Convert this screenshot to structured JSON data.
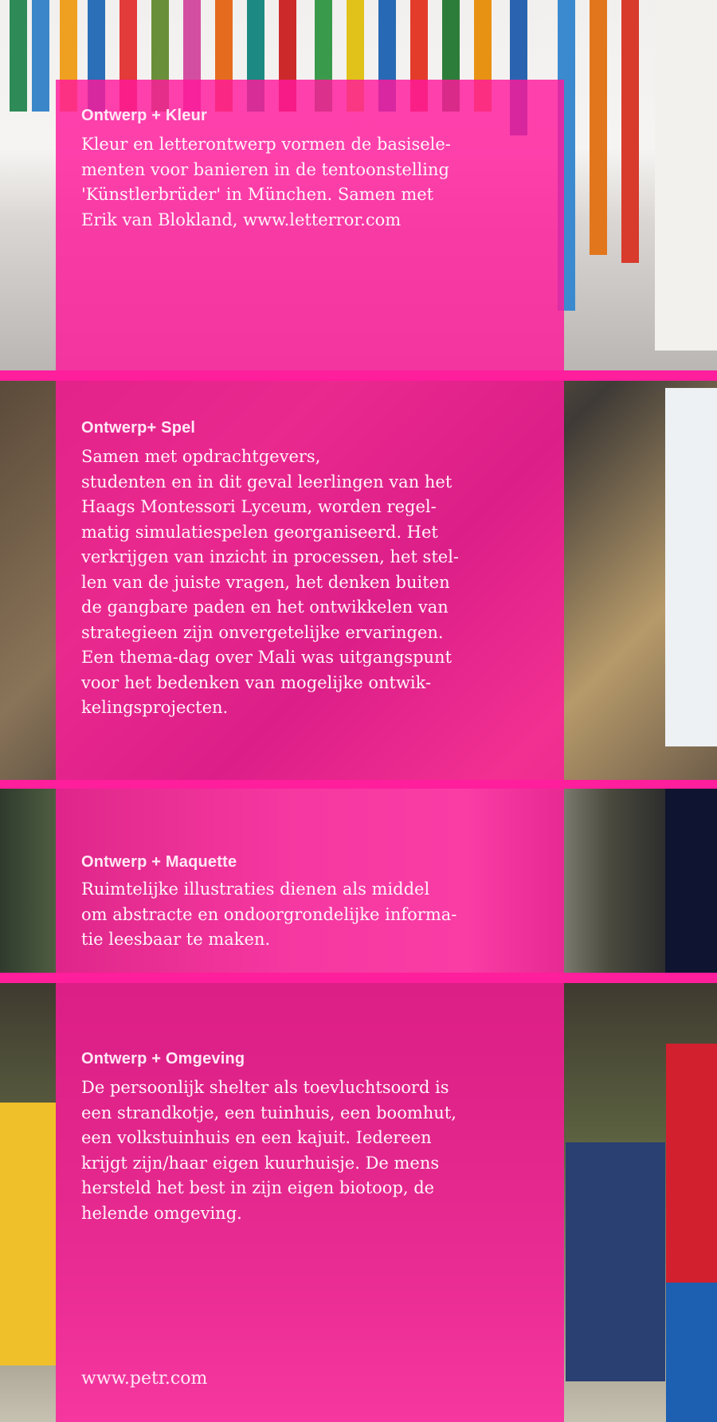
{
  "sections": [
    {
      "heading": "Ontwerp + Kleur",
      "lines": [
        "Kleur en letterontwerp vormen de basisele-",
        "menten voor banieren in de tentoonstelling",
        "'Künstlerbrüder' in München. Samen met",
        "Erik van Blokland, www.letterror.com"
      ]
    },
    {
      "heading": "Ontwerp+ Spel",
      "lines": [
        "Samen met opdrachtgevers,",
        "studenten en in dit geval leerlingen van het",
        "Haags Montessori Lyceum, worden regel-",
        "matig simulatiespelen georganiseerd. Het",
        "verkrijgen van inzicht in processen, het stel-",
        "len van de juiste vragen, het denken buiten",
        "de gangbare paden en het ontwikkelen van",
        "strategieen zijn onvergetelijke ervaringen.",
        "Een thema-dag over Mali was uitgangspunt",
        "voor het bedenken van mogelijke ontwik-",
        "kelingsprojecten."
      ]
    },
    {
      "heading": "Ontwerp + Maquette",
      "lines": [
        "Ruimtelijke illustraties dienen als middel",
        "om abstracte en ondoorgrondelijke informa-",
        "tie leesbaar te maken."
      ]
    },
    {
      "heading": "Ontwerp + Omgeving",
      "lines": [
        "De persoonlijk shelter als toevluchtsoord is",
        "een strandkotje, een tuinhuis, een boomhut,",
        "een volkstuinhuis en een kajuit. Iedereen",
        "krijgt zijn/haar eigen kuurhuisje. De mens",
        "hersteld het best in zijn eigen biotoop, de",
        "helende omgeving."
      ]
    }
  ],
  "footer": {
    "url": "www.petr.com"
  },
  "colors": {
    "accent": "#ff1e9c",
    "overlay": "rgba(255,25,155,0.82)"
  }
}
